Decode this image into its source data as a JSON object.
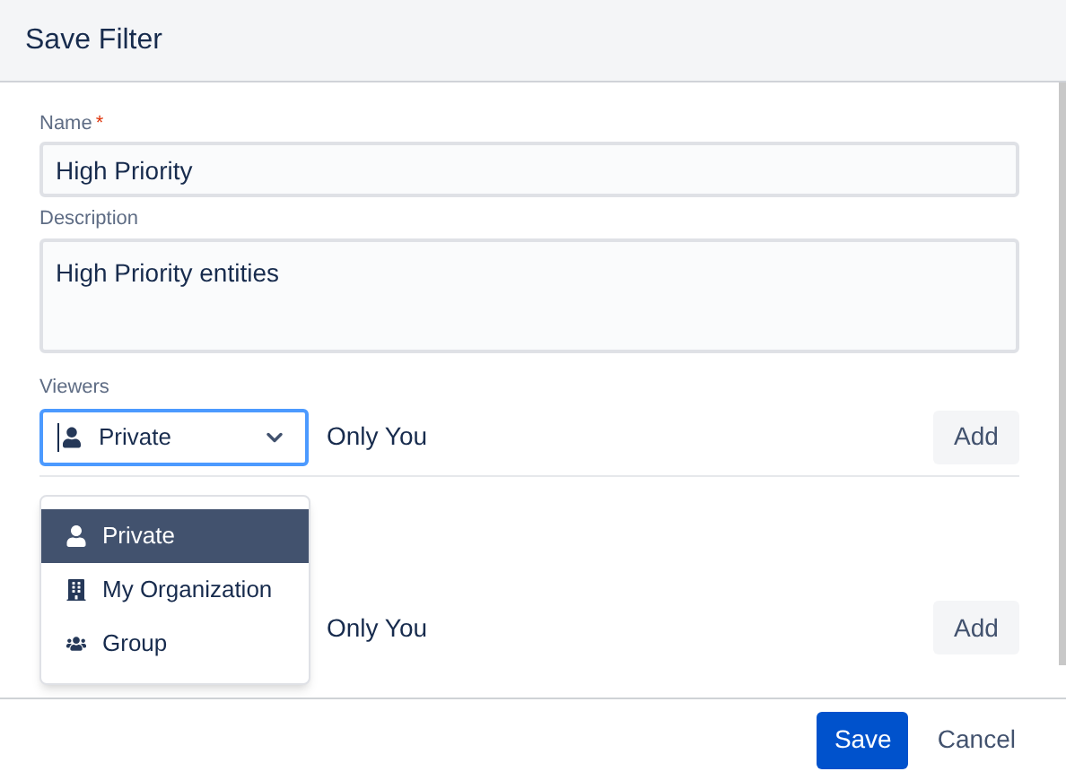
{
  "dialog": {
    "title": "Save Filter"
  },
  "name_field": {
    "label": "Name",
    "required_mark": "*",
    "value": "High Priority"
  },
  "description_field": {
    "label": "Description",
    "value": "High Priority entities"
  },
  "viewers": {
    "label": "Viewers",
    "rows": [
      {
        "select": {
          "value": "Private",
          "kind": "user"
        },
        "text": "Only You",
        "button": "Add"
      },
      {
        "text": "Only You",
        "button": "Add"
      }
    ],
    "dropdown": {
      "options": [
        {
          "label": "Private",
          "kind": "user",
          "selected": true
        },
        {
          "label": "My Organization",
          "kind": "building",
          "selected": false
        },
        {
          "label": "Group",
          "kind": "group",
          "selected": false
        }
      ]
    }
  },
  "footer": {
    "buttons": [
      {
        "label": "Save",
        "kind": "primary"
      },
      {
        "label": "Cancel",
        "kind": "link"
      }
    ]
  }
}
